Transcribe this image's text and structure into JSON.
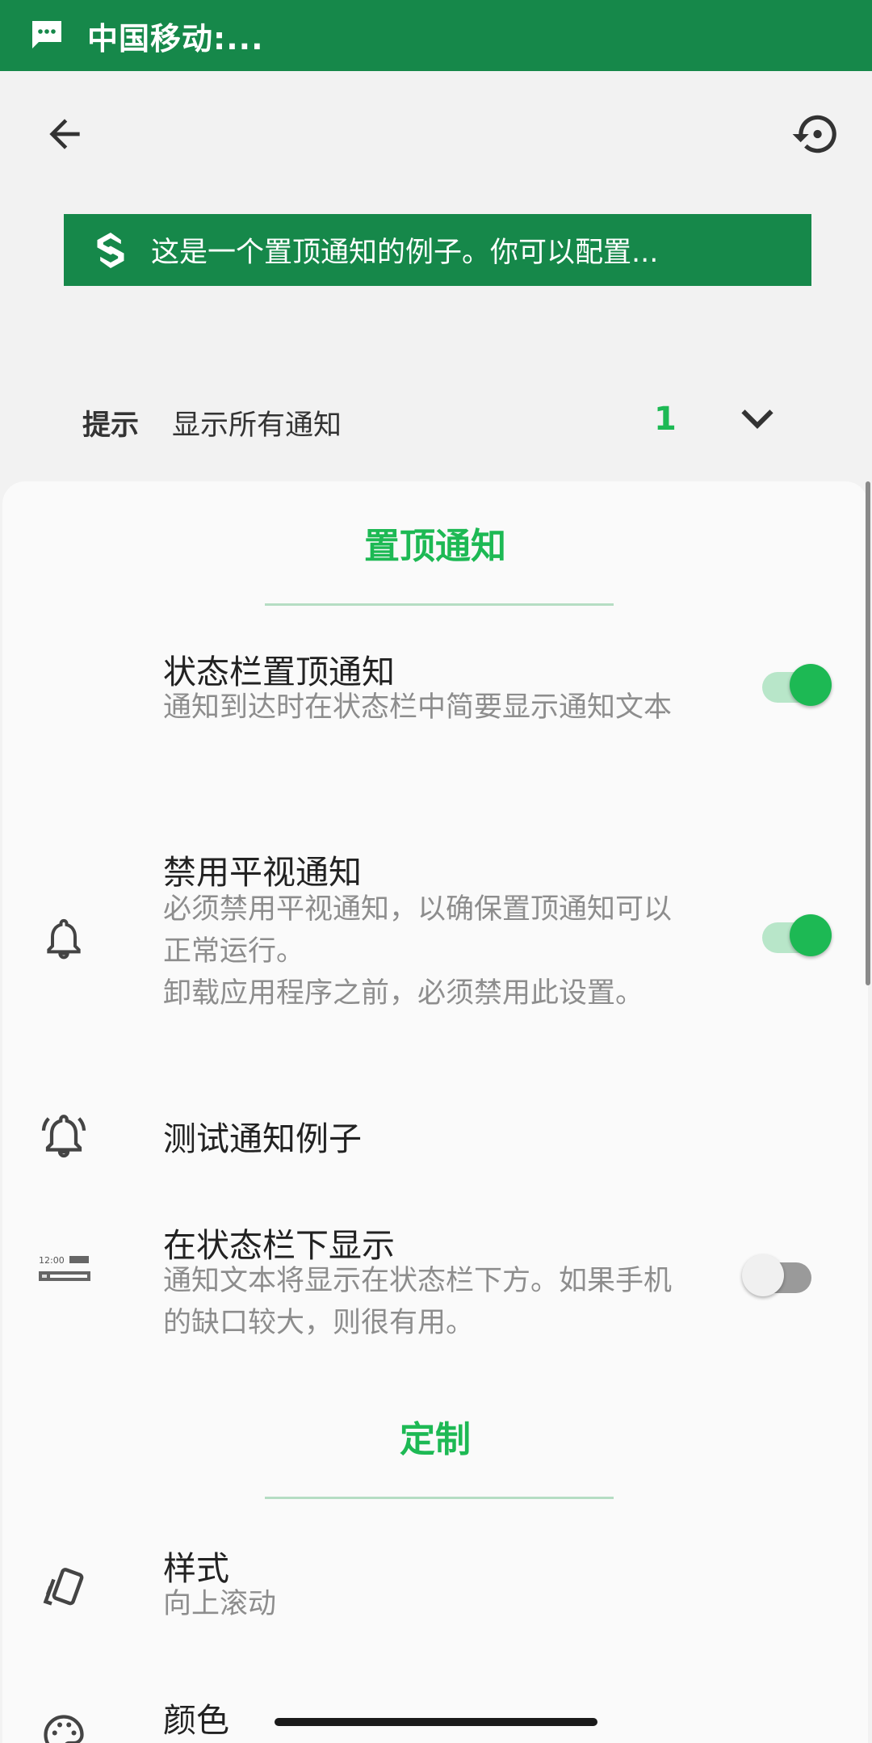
{
  "status_bar": {
    "text": "中国移动:...",
    "icon": "message-icon",
    "bg_color": "#16884a"
  },
  "app_bar": {
    "back_icon": "arrow-back-icon",
    "reset_icon": "restore-icon"
  },
  "banner": {
    "icon": "app-logo-icon",
    "text": "这是一个置顶通知的例子。你可以配置..."
  },
  "hint": {
    "label": "提示",
    "value": "显示所有通知",
    "count": "1",
    "icon": "chevron-down-icon"
  },
  "sections": {
    "pinned": {
      "title": "置顶通知",
      "items": [
        {
          "title": "状态栏置顶通知",
          "summary": "通知到达时在状态栏中简要显示通知文本",
          "switch_on": true
        },
        {
          "title": "禁用平视通知",
          "summary_lines": [
            "必须禁用平视通知，以确保置顶通知可以正常运行。",
            "卸载应用程序之前，必须禁用此设置。"
          ],
          "icon": "bell-icon",
          "switch_on": true
        },
        {
          "title": "测试通知例子",
          "icon": "bell-ringing-icon"
        },
        {
          "title": "在状态栏下显示",
          "summary": "通知文本将显示在状态栏下方。如果手机的缺口较大，则很有用。",
          "icon": "statusbar-preview-icon",
          "icon_label": "12:00",
          "switch_on": false
        }
      ]
    },
    "custom": {
      "title": "定制",
      "items": [
        {
          "title": "样式",
          "summary": "向上滚动",
          "icon": "cards-icon"
        },
        {
          "title": "颜色",
          "icon": "palette-icon"
        }
      ]
    }
  },
  "colors": {
    "accent": "#1db954",
    "primary_dark": "#16884a"
  }
}
